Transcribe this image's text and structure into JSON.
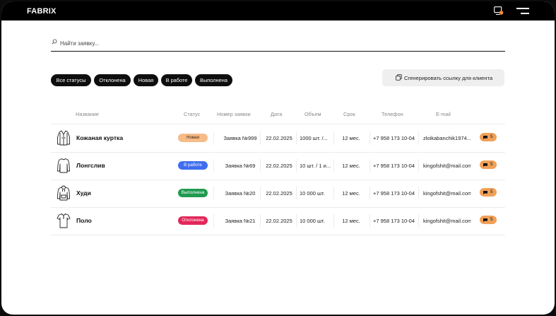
{
  "app": {
    "logo": "FABRIX"
  },
  "search": {
    "placeholder": "Найти заявку..."
  },
  "filters": [
    "Все статусы",
    "Отклонена",
    "Новая",
    "В работе",
    "Выполнена"
  ],
  "generate_button": {
    "label": "Сгенерировать ссылку для клиента"
  },
  "table": {
    "headers": {
      "name": "Название",
      "status": "Статус",
      "number": "Номер заявки",
      "date": "Дата",
      "volume": "Объем",
      "term": "Срок",
      "phone": "Телефон",
      "email": "E-mail"
    },
    "rows": [
      {
        "name": "Кожаная куртка",
        "icon": "jacket-icon",
        "status": "Новая",
        "status_bg": "#f7bb88",
        "status_fg": "#3a2410",
        "number": "Заявка №999",
        "date": "22.02.2025",
        "volume": "1000 шт. /...",
        "term": "12 мес.",
        "phone": "+7 958 173 10-04",
        "email": "zloikabanchik1974...",
        "comments": "5"
      },
      {
        "name": "Лонгслив",
        "icon": "longsleeve-icon",
        "status": "В работе",
        "status_bg": "#3e6df0",
        "status_fg": "#ffffff",
        "number": "Заявка №69",
        "date": "22.02.2025",
        "volume": "10 шт. / 1 и...",
        "term": "12 мес.",
        "phone": "+7 958 173 10-04",
        "email": "kingofshit@mail.com",
        "comments": "5"
      },
      {
        "name": "Худи",
        "icon": "hoodie-icon",
        "status": "Выполнена",
        "status_bg": "#1f9a4f",
        "status_fg": "#ffffff",
        "number": "Заявка №20",
        "date": "22.02.2025",
        "volume": "10 000 шт.",
        "term": "12 мес.",
        "phone": "+7 958 173 10-04",
        "email": "kingofshit@mail.com",
        "comments": "5"
      },
      {
        "name": "Поло",
        "icon": "polo-icon",
        "status": "Отклонена",
        "status_bg": "#e2285a",
        "status_fg": "#ffffff",
        "number": "Заявка №21",
        "date": "22.02.2025",
        "volume": "10 000 шт.",
        "term": "12 мес.",
        "phone": "+7 958 173 10-04",
        "email": "kingofshit@mail.com",
        "comments": "5"
      }
    ]
  },
  "colors": {
    "accent_orange": "#f0a158",
    "topbar": "#000000"
  }
}
